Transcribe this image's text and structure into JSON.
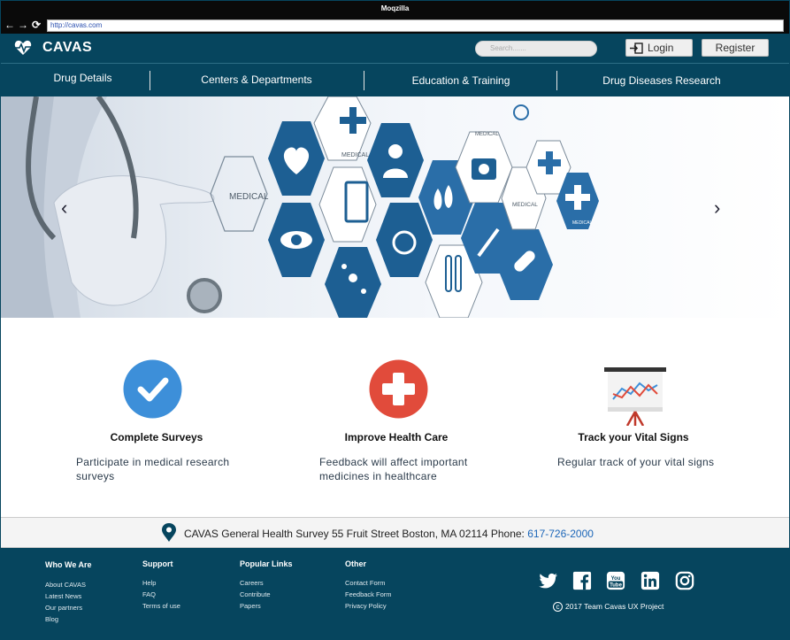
{
  "browser": {
    "title": "Moqzilla",
    "url": "http://cavas.com",
    "back_glyph": "←",
    "forward_glyph": "→",
    "reload_glyph": "⟳"
  },
  "header": {
    "logo_text": "CAVAS",
    "search_placeholder": "Search.......",
    "login_label": "Login",
    "register_label": "Register"
  },
  "nav": {
    "items": [
      "Drug Details",
      "Centers & Departments",
      "Education & Training",
      "Drug Diseases Research"
    ]
  },
  "hero": {
    "prev_glyph": "‹",
    "next_glyph": "›",
    "labels": [
      "MEDICAL",
      "MEDICAL",
      "MEDICAL",
      "MEDICAL",
      "MEDICAL"
    ]
  },
  "features": [
    {
      "title": "Complete Surveys",
      "desc": "Participate in medical research surveys",
      "icon": "check-circle-icon"
    },
    {
      "title": "Improve Health Care",
      "desc": "Feedback will affect important medicines in healthcare",
      "icon": "medical-cross-icon"
    },
    {
      "title": "Track your Vital Signs",
      "desc": "Regular track of your vital signs",
      "icon": "chart-board-icon"
    }
  ],
  "address": {
    "text": "CAVAS General Health Survey 55 Fruit Street Boston, MA 02114 Phone: ",
    "phone": "617-726-2000"
  },
  "footer": {
    "columns": [
      {
        "heading": "Who We Are",
        "links": [
          "About CAVAS",
          "Latest News",
          "Our partners",
          "Blog"
        ]
      },
      {
        "heading": "Support",
        "links": [
          "Help",
          "FAQ",
          "Terms of use"
        ]
      },
      {
        "heading": "Popular Links",
        "links": [
          "Careers",
          "Contribute",
          "Papers"
        ]
      },
      {
        "heading": "Other",
        "links": [
          "Contact Form",
          "Feedback Form",
          "Privacy Policy"
        ]
      }
    ],
    "social": [
      "twitter-icon",
      "facebook-icon",
      "youtube-icon",
      "linkedin-icon",
      "instagram-icon"
    ],
    "copyright_symbol": "c",
    "copyright": "2017 Team Cavas UX Project"
  },
  "colors": {
    "brand": "#06455e",
    "check": "#3d8fd9",
    "cross": "#e14b3b",
    "phone": "#1c66b8"
  }
}
